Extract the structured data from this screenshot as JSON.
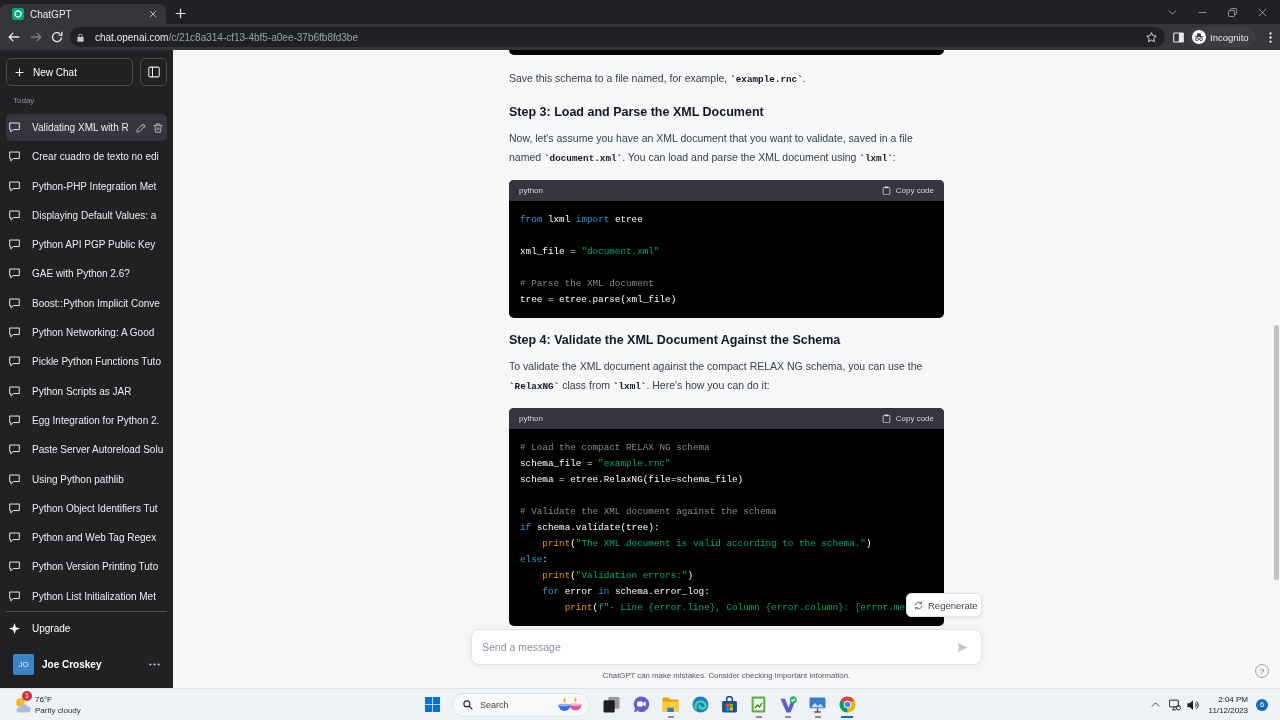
{
  "browser": {
    "tab": {
      "title": "ChatGPT"
    },
    "nav": [
      {
        "kind": "back",
        "disabled": false
      },
      {
        "kind": "forward",
        "disabled": true
      },
      {
        "kind": "reload",
        "disabled": false
      }
    ],
    "address": {
      "host": "chat.openai.com",
      "path": "/c/21c8a314-cf13-4bf5-a0ee-37b6fb8fd3be"
    },
    "profile": {
      "label": "Incognito"
    }
  },
  "sidebar": {
    "new_chat": "New Chat",
    "section": "Today",
    "chats": [
      {
        "title": "Validating XML with R",
        "selected": true
      },
      {
        "title": "Crear cuadro de texto no edi",
        "selected": false
      },
      {
        "title": "Python-PHP Integration Met",
        "selected": false
      },
      {
        "title": "Displaying Default Values: a",
        "selected": false
      },
      {
        "title": "Python API PGP Public Key",
        "selected": false
      },
      {
        "title": "GAE with Python 2.6?",
        "selected": false
      },
      {
        "title": "Boost::Python Implicit Conve",
        "selected": false
      },
      {
        "title": "Python Networking: A Good",
        "selected": false
      },
      {
        "title": "Pickle Python Functions Tuto",
        "selected": false
      },
      {
        "title": "Python Scripts as JAR",
        "selected": false
      },
      {
        "title": "Egg Integration for Python 2.",
        "selected": false
      },
      {
        "title": "Paste Server Autoreload Solu",
        "selected": false
      },
      {
        "title": "Using Python pathlib",
        "selected": false
      },
      {
        "title": "Python Object Identifiers Tut",
        "selected": false
      },
      {
        "title": "Python and Web Tag Regex",
        "selected": false
      },
      {
        "title": "Python Version Printing Tuto",
        "selected": false
      },
      {
        "title": "Python List Initialization Met",
        "selected": false
      }
    ],
    "upgrade": "Upgrade",
    "user": {
      "initials": "JO",
      "name": "Joe Croskey"
    }
  },
  "conversation": {
    "blocks": [
      {
        "kind": "code_end"
      },
      {
        "kind": "paragraph",
        "text": "Save this schema to a file named, for example, **`example.rnc`**."
      },
      {
        "kind": "heading",
        "text": "Step 3: Load and Parse the XML Document"
      },
      {
        "kind": "paragraph",
        "text": "Now, let's assume you have an XML document that you want to validate, saved in a file named **`document.xml`**. You can load and parse the XML document using **`lxml`**:"
      },
      {
        "kind": "code",
        "language": "python",
        "copy_label": "Copy code",
        "lines": [
          {
            "kind": "code",
            "tokens": [
              {
                "kind": "keyword",
                "text": "from"
              },
              {
                "kind": "plain",
                "text": " lxml "
              },
              {
                "kind": "keyword",
                "text": "import"
              },
              {
                "kind": "plain",
                "text": " etree"
              }
            ]
          },
          {
            "kind": "blank"
          },
          {
            "kind": "code",
            "tokens": [
              {
                "kind": "plain",
                "text": "xml_file = "
              },
              {
                "kind": "string",
                "text": "\"document.xml\""
              }
            ]
          },
          {
            "kind": "blank"
          },
          {
            "kind": "code",
            "tokens": [
              {
                "kind": "comment",
                "text": "# Parse the XML document"
              }
            ]
          },
          {
            "kind": "code",
            "tokens": [
              {
                "kind": "plain",
                "text": "tree = etree.parse(xml_file)"
              }
            ]
          }
        ]
      },
      {
        "kind": "heading",
        "text": "Step 4: Validate the XML Document Against the Schema"
      },
      {
        "kind": "paragraph",
        "text": "To validate the XML document against the compact RELAX NG schema, you can use the **`RelaxNG`** class from **`lxml`**. Here's how you can do it:"
      },
      {
        "kind": "code",
        "language": "python",
        "copy_label": "Copy code",
        "lines": [
          {
            "kind": "code",
            "tokens": [
              {
                "kind": "comment",
                "text": "# Load the compact RELAX NG schema"
              }
            ]
          },
          {
            "kind": "code",
            "tokens": [
              {
                "kind": "plain",
                "text": "schema_file = "
              },
              {
                "kind": "string",
                "text": "\"example.rnc\""
              }
            ]
          },
          {
            "kind": "code",
            "tokens": [
              {
                "kind": "plain",
                "text": "schema = etree.RelaxNG(file=schema_file)"
              }
            ]
          },
          {
            "kind": "blank"
          },
          {
            "kind": "code",
            "tokens": [
              {
                "kind": "comment",
                "text": "# Validate the XML document against the schema"
              }
            ]
          },
          {
            "kind": "code",
            "tokens": [
              {
                "kind": "keyword",
                "text": "if"
              },
              {
                "kind": "plain",
                "text": " schema.validate(tree):"
              }
            ],
            "children": [
              {
                "kind": "code",
                "tokens": [
                  {
                    "kind": "builtin",
                    "text": "print"
                  },
                  {
                    "kind": "plain",
                    "text": "("
                  },
                  {
                    "kind": "string",
                    "text": "\"The XML document is valid according to the schema.\""
                  },
                  {
                    "kind": "plain",
                    "text": ")"
                  }
                ]
              }
            ]
          },
          {
            "kind": "code",
            "tokens": [
              {
                "kind": "keyword",
                "text": "else"
              },
              {
                "kind": "plain",
                "text": ":"
              }
            ],
            "children": [
              {
                "kind": "code",
                "tokens": [
                  {
                    "kind": "builtin",
                    "text": "print"
                  },
                  {
                    "kind": "plain",
                    "text": "("
                  },
                  {
                    "kind": "string",
                    "text": "\"Validation errors:\""
                  },
                  {
                    "kind": "plain",
                    "text": ")"
                  }
                ]
              },
              {
                "kind": "code",
                "tokens": [
                  {
                    "kind": "keyword",
                    "text": "for"
                  },
                  {
                    "kind": "plain",
                    "text": " error "
                  },
                  {
                    "kind": "keyword",
                    "text": "in"
                  },
                  {
                    "kind": "plain",
                    "text": " schema.error_log:"
                  }
                ],
                "children": [
                  {
                    "kind": "code",
                    "tokens": [
                      {
                        "kind": "builtin",
                        "text": "print"
                      },
                      {
                        "kind": "plain",
                        "text": "("
                      },
                      {
                        "kind": "string",
                        "text": "f\"- Line {error.line}, Column {error.column}: {error.me"
                      }
                    ]
                  }
                ]
              }
            ]
          }
        ]
      }
    ],
    "regenerate": "Regenerate"
  },
  "composer": {
    "placeholder": "Send a message",
    "disclaimer": "ChatGPT can make mistakes. Consider checking important information."
  },
  "help": "?",
  "taskbar": {
    "weather": {
      "badge": "1",
      "temperature": "76°F",
      "condition": "Partly cloudy"
    },
    "search": {
      "placeholder": "Search"
    },
    "apps": [
      {
        "kind": "task-view",
        "running": false,
        "active": false
      },
      {
        "kind": "video-chat",
        "running": false,
        "active": false
      },
      {
        "kind": "folder",
        "running": true,
        "active": false
      },
      {
        "kind": "swirl",
        "running": false,
        "active": false
      },
      {
        "kind": "bag",
        "running": false,
        "active": false
      },
      {
        "kind": "notepad",
        "running": true,
        "active": false
      },
      {
        "kind": "v-check",
        "running": true,
        "active": false
      },
      {
        "kind": "picture",
        "running": true,
        "active": false
      },
      {
        "kind": "tricolor",
        "running": true,
        "active": true
      }
    ],
    "clock": {
      "time": "2:04 PM",
      "date": "11/12/2023"
    },
    "notifications": "6"
  }
}
